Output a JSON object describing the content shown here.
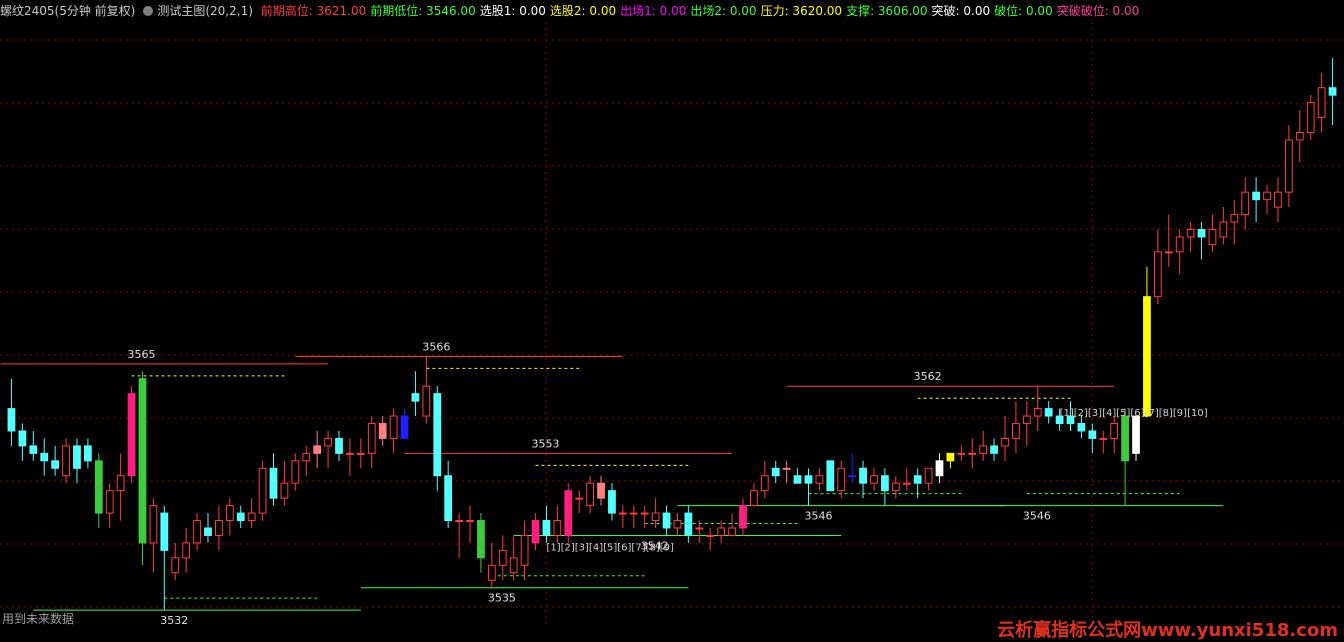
{
  "header": {
    "symbol": "螺纹2405(5分钟 前复权)",
    "indicator_name": "测试主图(20,2,1)",
    "values": [
      {
        "label": "前期高位:",
        "value": "3621.00",
        "color": "#ff3c3c"
      },
      {
        "label": "前期低位:",
        "value": "3546.00",
        "color": "#3cff3c"
      },
      {
        "label": "选股1:",
        "value": "0.00",
        "color": "#ffffff"
      },
      {
        "label": "选股2:",
        "value": "0.00",
        "color": "#ffff00"
      },
      {
        "label": "出场1:",
        "value": "0.00",
        "color": "#ff00ff"
      },
      {
        "label": "出场2:",
        "value": "0.00",
        "color": "#3cff3c"
      },
      {
        "label": "压力:",
        "value": "3620.00",
        "color": "#ffff00"
      },
      {
        "label": "支撑:",
        "value": "3606.00",
        "color": "#3cff3c"
      },
      {
        "label": "突破:",
        "value": "0.00",
        "color": "#ffffff"
      },
      {
        "label": "破位:",
        "value": "0.00",
        "color": "#3cff3c"
      },
      {
        "label": "突破破位:",
        "value": "0.00",
        "color": "#ff3c9a"
      }
    ]
  },
  "footnote": "用到未来数据",
  "watermark": "云析赢指标公式网www.yunxi518.com",
  "chart_data": {
    "type": "candlestick",
    "price_range": [
      3530,
      3610
    ],
    "colors": {
      "up": "#ff3c3c",
      "down": "#54ffff",
      "grid": "#8b0000",
      "high_line": "#ff3c3c",
      "low_line": "#3cff3c",
      "resistance": "#ffff00",
      "support": "#3cff3c"
    },
    "candles": [
      {
        "o": 3559,
        "h": 3563,
        "l": 3554,
        "c": 3556
      },
      {
        "o": 3556,
        "h": 3557,
        "l": 3552,
        "c": 3554
      },
      {
        "o": 3554,
        "h": 3556,
        "l": 3552,
        "c": 3553
      },
      {
        "o": 3553,
        "h": 3555,
        "l": 3550,
        "c": 3552
      },
      {
        "o": 3552,
        "h": 3554,
        "l": 3550,
        "c": 3551
      },
      {
        "o": 3550,
        "h": 3555,
        "l": 3549,
        "c": 3554
      },
      {
        "o": 3554,
        "h": 3555,
        "l": 3549,
        "c": 3551
      },
      {
        "o": 3554,
        "h": 3555,
        "l": 3551,
        "c": 3552
      },
      {
        "o": 3552,
        "h": 3553,
        "l": 3543,
        "c": 3545,
        "color": "#3ccc3c"
      },
      {
        "o": 3545,
        "h": 3549,
        "l": 3543,
        "c": 3548
      },
      {
        "o": 3548,
        "h": 3553,
        "l": 3544,
        "c": 3550
      },
      {
        "o": 3550,
        "h": 3562,
        "l": 3549,
        "c": 3561,
        "color": "#ff1f7d"
      },
      {
        "o": 3563,
        "h": 3564,
        "l": 3538,
        "c": 3541,
        "color": "#3ccc3c"
      },
      {
        "o": 3541,
        "h": 3547,
        "l": 3537,
        "c": 3546
      },
      {
        "o": 3545,
        "h": 3546,
        "l": 3532,
        "c": 3540
      },
      {
        "o": 3537,
        "h": 3541,
        "l": 3536,
        "c": 3539
      },
      {
        "o": 3539,
        "h": 3543,
        "l": 3537,
        "c": 3541
      },
      {
        "o": 3541,
        "h": 3545,
        "l": 3540,
        "c": 3544
      },
      {
        "o": 3543,
        "h": 3545,
        "l": 3541,
        "c": 3542
      },
      {
        "o": 3542,
        "h": 3546,
        "l": 3540,
        "c": 3544
      },
      {
        "o": 3544,
        "h": 3547,
        "l": 3542,
        "c": 3546
      },
      {
        "o": 3545,
        "h": 3546,
        "l": 3543,
        "c": 3544
      },
      {
        "o": 3544,
        "h": 3547,
        "l": 3543,
        "c": 3545
      },
      {
        "o": 3545,
        "h": 3552,
        "l": 3544,
        "c": 3551
      },
      {
        "o": 3551,
        "h": 3553,
        "l": 3546,
        "c": 3547
      },
      {
        "o": 3547,
        "h": 3552,
        "l": 3546,
        "c": 3549
      },
      {
        "o": 3549,
        "h": 3553,
        "l": 3548,
        "c": 3552
      },
      {
        "o": 3552,
        "h": 3554,
        "l": 3550,
        "c": 3553
      },
      {
        "o": 3553,
        "h": 3556,
        "l": 3551,
        "c": 3554,
        "color": "#ff8080"
      },
      {
        "o": 3554,
        "h": 3556,
        "l": 3551,
        "c": 3555
      },
      {
        "o": 3555,
        "h": 3556,
        "l": 3552,
        "c": 3553
      },
      {
        "o": 3553,
        "h": 3555,
        "l": 3550,
        "c": 3553
      },
      {
        "o": 3553,
        "h": 3555,
        "l": 3551,
        "c": 3553
      },
      {
        "o": 3553,
        "h": 3558,
        "l": 3551,
        "c": 3557
      },
      {
        "o": 3555,
        "h": 3558,
        "l": 3554,
        "c": 3557,
        "color": "#ff8080"
      },
      {
        "o": 3555,
        "h": 3559,
        "l": 3553,
        "c": 3558
      },
      {
        "o": 3558,
        "h": 3559,
        "l": 3555,
        "c": 3555,
        "color": "#2020ff"
      },
      {
        "o": 3561,
        "h": 3564,
        "l": 3558,
        "c": 3560
      },
      {
        "o": 3558,
        "h": 3566,
        "l": 3557,
        "c": 3562
      },
      {
        "o": 3561,
        "h": 3562,
        "l": 3548,
        "c": 3550
      },
      {
        "o": 3550,
        "h": 3552,
        "l": 3543,
        "c": 3544
      },
      {
        "o": 3544,
        "h": 3545,
        "l": 3539,
        "c": 3544
      },
      {
        "o": 3544,
        "h": 3546,
        "l": 3541,
        "c": 3544
      },
      {
        "o": 3544,
        "h": 3545,
        "l": 3537,
        "c": 3539,
        "color": "#3ccc3c"
      },
      {
        "o": 3536,
        "h": 3541,
        "l": 3535,
        "c": 3538
      },
      {
        "o": 3538,
        "h": 3542,
        "l": 3536,
        "c": 3540
      },
      {
        "o": 3537,
        "h": 3542,
        "l": 3536,
        "c": 3539
      },
      {
        "o": 3538,
        "h": 3544,
        "l": 3536,
        "c": 3542
      },
      {
        "o": 3541,
        "h": 3545,
        "l": 3540,
        "c": 3544,
        "color": "#ff1f7d"
      },
      {
        "o": 3544,
        "h": 3546,
        "l": 3541,
        "c": 3542
      },
      {
        "o": 3542,
        "h": 3546,
        "l": 3541,
        "c": 3544
      },
      {
        "o": 3542,
        "h": 3549,
        "l": 3541,
        "c": 3548,
        "color": "#ff1f7d"
      },
      {
        "o": 3547,
        "h": 3548,
        "l": 3545,
        "c": 3547
      },
      {
        "o": 3546,
        "h": 3550,
        "l": 3545,
        "c": 3549
      },
      {
        "o": 3547,
        "h": 3550,
        "l": 3546,
        "c": 3549,
        "color": "#ff8080"
      },
      {
        "o": 3548,
        "h": 3549,
        "l": 3544,
        "c": 3545
      },
      {
        "o": 3545,
        "h": 3546,
        "l": 3543,
        "c": 3545
      },
      {
        "o": 3545,
        "h": 3546,
        "l": 3543,
        "c": 3545
      },
      {
        "o": 3545,
        "h": 3546,
        "l": 3543,
        "c": 3545
      },
      {
        "o": 3544,
        "h": 3547,
        "l": 3543,
        "c": 3545
      },
      {
        "o": 3545,
        "h": 3546,
        "l": 3542,
        "c": 3543
      },
      {
        "o": 3543,
        "h": 3545,
        "l": 3542,
        "c": 3544
      },
      {
        "o": 3545,
        "h": 3546,
        "l": 3541,
        "c": 3542
      },
      {
        "o": 3543,
        "h": 3544,
        "l": 3541,
        "c": 3543
      },
      {
        "o": 3542,
        "h": 3543,
        "l": 3540,
        "c": 3542
      },
      {
        "o": 3542,
        "h": 3544,
        "l": 3541,
        "c": 3543
      },
      {
        "o": 3542,
        "h": 3545,
        "l": 3542,
        "c": 3543
      },
      {
        "o": 3543,
        "h": 3547,
        "l": 3542,
        "c": 3546,
        "color": "#ff1f7d"
      },
      {
        "o": 3546,
        "h": 3549,
        "l": 3546,
        "c": 3548
      },
      {
        "o": 3548,
        "h": 3552,
        "l": 3547,
        "c": 3550
      },
      {
        "o": 3551,
        "h": 3552,
        "l": 3549,
        "c": 3550
      },
      {
        "o": 3551,
        "h": 3552,
        "l": 3549,
        "c": 3551,
        "color": "#ff8080"
      },
      {
        "o": 3550,
        "h": 3551,
        "l": 3549,
        "c": 3549
      },
      {
        "o": 3550,
        "h": 3551,
        "l": 3546,
        "c": 3549
      },
      {
        "o": 3549,
        "h": 3551,
        "l": 3548,
        "c": 3550
      },
      {
        "o": 3552,
        "h": 3552,
        "l": 3548,
        "c": 3548
      },
      {
        "o": 3548,
        "h": 3552,
        "l": 3547,
        "c": 3551
      },
      {
        "o": 3550,
        "h": 3553,
        "l": 3549,
        "c": 3550,
        "color": "#2020ff"
      },
      {
        "o": 3551,
        "h": 3552,
        "l": 3547,
        "c": 3549
      },
      {
        "o": 3549,
        "h": 3551,
        "l": 3548,
        "c": 3550
      },
      {
        "o": 3550,
        "h": 3551,
        "l": 3546,
        "c": 3548
      },
      {
        "o": 3548,
        "h": 3550,
        "l": 3547,
        "c": 3549
      },
      {
        "o": 3549,
        "h": 3551,
        "l": 3548,
        "c": 3549
      },
      {
        "o": 3550,
        "h": 3551,
        "l": 3547,
        "c": 3549
      },
      {
        "o": 3549,
        "h": 3551,
        "l": 3548,
        "c": 3551
      },
      {
        "o": 3550,
        "h": 3553,
        "l": 3549,
        "c": 3552,
        "color": "#ffffff"
      },
      {
        "o": 3552,
        "h": 3553,
        "l": 3551,
        "c": 3553,
        "color": "#ffff00"
      },
      {
        "o": 3553,
        "h": 3554,
        "l": 3552,
        "c": 3553
      },
      {
        "o": 3553,
        "h": 3555,
        "l": 3551,
        "c": 3553
      },
      {
        "o": 3553,
        "h": 3556,
        "l": 3552,
        "c": 3554
      },
      {
        "o": 3554,
        "h": 3555,
        "l": 3552,
        "c": 3553
      },
      {
        "o": 3554,
        "h": 3558,
        "l": 3552,
        "c": 3555
      },
      {
        "o": 3555,
        "h": 3560,
        "l": 3553,
        "c": 3557
      },
      {
        "o": 3557,
        "h": 3560,
        "l": 3554,
        "c": 3558
      },
      {
        "o": 3558,
        "h": 3562,
        "l": 3556,
        "c": 3559
      },
      {
        "o": 3559,
        "h": 3560,
        "l": 3557,
        "c": 3558
      },
      {
        "o": 3558,
        "h": 3559,
        "l": 3556,
        "c": 3557
      },
      {
        "o": 3558,
        "h": 3560,
        "l": 3556,
        "c": 3557
      },
      {
        "o": 3557,
        "h": 3558,
        "l": 3555,
        "c": 3556
      },
      {
        "o": 3556,
        "h": 3557,
        "l": 3553,
        "c": 3555
      },
      {
        "o": 3555,
        "h": 3556,
        "l": 3553,
        "c": 3555
      },
      {
        "o": 3555,
        "h": 3558,
        "l": 3553,
        "c": 3557
      },
      {
        "o": 3558,
        "h": 3559,
        "l": 3546,
        "c": 3552,
        "color": "#3ccc3c"
      },
      {
        "o": 3553,
        "h": 3558,
        "l": 3552,
        "c": 3558,
        "color": "#ffffff"
      },
      {
        "o": 3558,
        "h": 3578,
        "l": 3558,
        "c": 3574,
        "color": "#ffff00"
      },
      {
        "o": 3574,
        "h": 3583,
        "l": 3573,
        "c": 3580
      },
      {
        "o": 3580,
        "h": 3585,
        "l": 3578,
        "c": 3580
      },
      {
        "o": 3580,
        "h": 3583,
        "l": 3577,
        "c": 3582
      },
      {
        "o": 3582,
        "h": 3584,
        "l": 3580,
        "c": 3583
      },
      {
        "o": 3583,
        "h": 3584,
        "l": 3579,
        "c": 3582
      },
      {
        "o": 3581,
        "h": 3585,
        "l": 3580,
        "c": 3583
      },
      {
        "o": 3582,
        "h": 3586,
        "l": 3581,
        "c": 3584
      },
      {
        "o": 3584,
        "h": 3587,
        "l": 3581,
        "c": 3585
      },
      {
        "o": 3585,
        "h": 3590,
        "l": 3583,
        "c": 3588
      },
      {
        "o": 3588,
        "h": 3590,
        "l": 3584,
        "c": 3587
      },
      {
        "o": 3587,
        "h": 3589,
        "l": 3585,
        "c": 3588
      },
      {
        "o": 3586,
        "h": 3590,
        "l": 3584,
        "c": 3588
      },
      {
        "o": 3588,
        "h": 3597,
        "l": 3586,
        "c": 3595
      },
      {
        "o": 3595,
        "h": 3599,
        "l": 3592,
        "c": 3596
      },
      {
        "o": 3596,
        "h": 3601,
        "l": 3595,
        "c": 3600
      },
      {
        "o": 3598,
        "h": 3604,
        "l": 3596,
        "c": 3602
      },
      {
        "o": 3602,
        "h": 3606,
        "l": 3597,
        "c": 3601
      }
    ],
    "pivot_labels": [
      {
        "text": "3565",
        "index": 11,
        "pos": "high",
        "price": 3565
      },
      {
        "text": "3532",
        "index": 14,
        "pos": "low",
        "price": 3532
      },
      {
        "text": "3566",
        "index": 38,
        "pos": "high",
        "price": 3566
      },
      {
        "text": "3535",
        "index": 44,
        "pos": "low",
        "price": 3535
      },
      {
        "text": "3553",
        "index": 48,
        "pos": "high",
        "price": 3553
      },
      {
        "text": "3542",
        "index": 58,
        "pos": "low",
        "price": 3542
      },
      {
        "text": "3546",
        "index": 73,
        "pos": "low",
        "price": 3546
      },
      {
        "text": "3562",
        "index": 83,
        "pos": "high",
        "price": 3562
      },
      {
        "text": "3546",
        "index": 93,
        "pos": "low",
        "price": 3546
      }
    ],
    "count_labels": [
      {
        "text": "[1][2][3][4][5][6][7][8][9]",
        "index": 49,
        "price": 3540
      },
      {
        "text": "[1][2][3][4][5][6][7][8][9][10]",
        "index": 96,
        "price": 3558
      }
    ]
  }
}
